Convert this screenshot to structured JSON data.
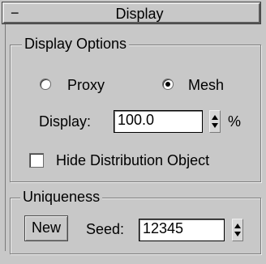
{
  "rollout": {
    "collapse_symbol": "−",
    "title": "Display"
  },
  "display_options": {
    "label": "Display Options",
    "radio_proxy": {
      "label": "Proxy",
      "selected": false
    },
    "radio_mesh": {
      "label": "Mesh",
      "selected": true
    },
    "display_label": "Display:",
    "display_value": "100.0",
    "display_unit": "%",
    "hide_distribution": {
      "label": "Hide Distribution Object",
      "checked": false
    }
  },
  "uniqueness": {
    "label": "Uniqueness",
    "new_button": "New",
    "seed_label": "Seed:",
    "seed_value": "12345"
  },
  "icons": {
    "spinner": "up-down-spinner-icon",
    "radio": "radio-dot-icon"
  }
}
